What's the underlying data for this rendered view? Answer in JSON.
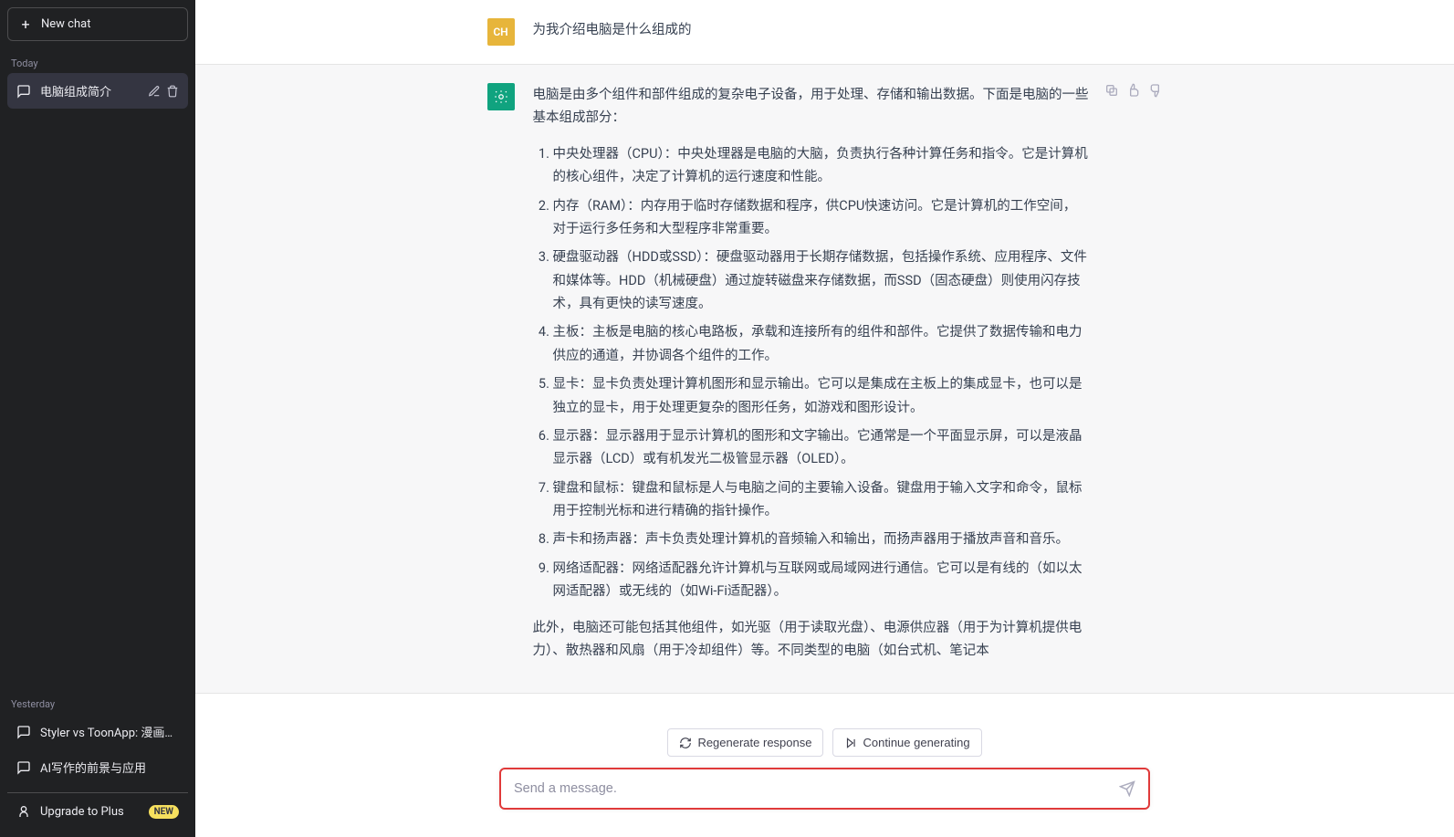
{
  "sidebar": {
    "new_chat_label": "New chat",
    "today_label": "Today",
    "yesterday_label": "Yesterday",
    "today_items": [
      {
        "title": "电脑组成简介",
        "active": true
      }
    ],
    "yesterday_items": [
      {
        "title": "Styler vs ToonApp: 漫画脸优劣"
      },
      {
        "title": "AI写作的前景与应用"
      }
    ],
    "upgrade_label": "Upgrade to Plus",
    "upgrade_badge": "NEW"
  },
  "conversation": {
    "user_avatar_text": "CH",
    "user_message": "为我介绍电脑是什么组成的",
    "assistant_intro": "电脑是由多个组件和部件组成的复杂电子设备，用于处理、存储和输出数据。下面是电脑的一些基本组成部分：",
    "assistant_items": [
      "中央处理器（CPU）：中央处理器是电脑的大脑，负责执行各种计算任务和指令。它是计算机的核心组件，决定了计算机的运行速度和性能。",
      "内存（RAM）：内存用于临时存储数据和程序，供CPU快速访问。它是计算机的工作空间，对于运行多任务和大型程序非常重要。",
      "硬盘驱动器（HDD或SSD）：硬盘驱动器用于长期存储数据，包括操作系统、应用程序、文件和媒体等。HDD（机械硬盘）通过旋转磁盘来存储数据，而SSD（固态硬盘）则使用闪存技术，具有更快的读写速度。",
      "主板：主板是电脑的核心电路板，承载和连接所有的组件和部件。它提供了数据传输和电力供应的通道，并协调各个组件的工作。",
      "显卡：显卡负责处理计算机图形和显示输出。它可以是集成在主板上的集成显卡，也可以是独立的显卡，用于处理更复杂的图形任务，如游戏和图形设计。",
      "显示器：显示器用于显示计算机的图形和文字输出。它通常是一个平面显示屏，可以是液晶显示器（LCD）或有机发光二极管显示器（OLED）。",
      "键盘和鼠标：键盘和鼠标是人与电脑之间的主要输入设备。键盘用于输入文字和命令，鼠标用于控制光标和进行精确的指针操作。",
      "声卡和扬声器：声卡负责处理计算机的音频输入和输出，而扬声器用于播放声音和音乐。",
      "网络适配器：网络适配器允许计算机与互联网或局域网进行通信。它可以是有线的（如以太网适配器）或无线的（如Wi-Fi适配器）。"
    ],
    "assistant_outro": "此外，电脑还可能包括其他组件，如光驱（用于读取光盘）、电源供应器（用于为计算机提供电力）、散热器和风扇（用于冷却组件）等。不同类型的电脑（如台式机、笔记本"
  },
  "actions": {
    "regenerate_label": "Regenerate response",
    "continue_label": "Continue generating"
  },
  "composer": {
    "placeholder": "Send a message."
  }
}
